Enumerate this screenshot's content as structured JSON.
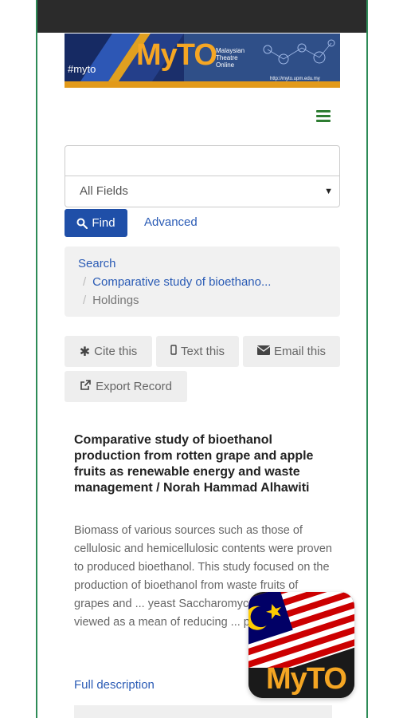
{
  "banner": {
    "hashtag": "#myto",
    "brand": "MyTO",
    "subtitle_line1": "Malaysian",
    "subtitle_line2": "Theatre",
    "subtitle_line3": "Online",
    "url": "http://myto.upm.edu.my"
  },
  "search": {
    "value": "",
    "placeholder": "",
    "field_selected": "All Fields",
    "find_label": "Find",
    "advanced_label": "Advanced"
  },
  "breadcrumb": {
    "items": [
      "Search",
      "Comparative study of bioethano...",
      "Holdings"
    ]
  },
  "tools": {
    "cite": "Cite this",
    "text": "Text this",
    "email": "Email this",
    "export": "Export Record"
  },
  "record": {
    "title": "Comparative study of bioethanol production from rotten grape and apple fruits as renewable energy and waste management / Norah Hammad Alhawiti",
    "description": "Biomass of various sources such as those of cellulosic and hemicellulosic contents were proven to produced bioethanol. This study focused on the production of bioethanol from waste fruits of grapes and ... yeast Saccharomyces cerevisiae ... viewed as a mean of reducing ... p...",
    "full_description": "Full description"
  },
  "logo": {
    "text": "MyTO"
  },
  "colors": {
    "accent_green": "#2e8b57",
    "button_blue": "#1f4fa8",
    "link_blue": "#2a5bb5"
  }
}
